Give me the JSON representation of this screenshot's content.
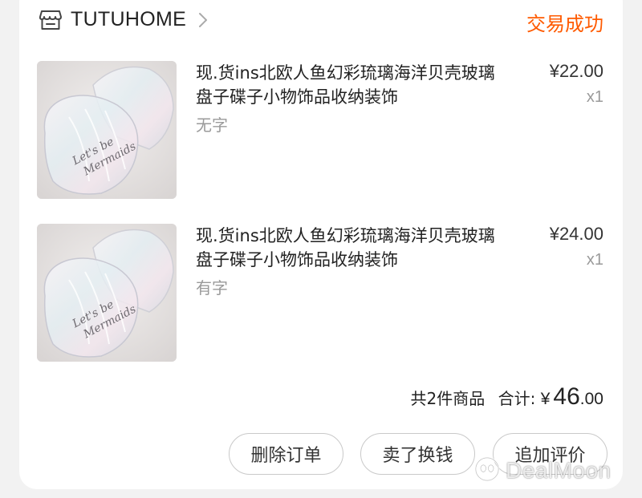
{
  "header": {
    "shop_name": "TUTUHOME",
    "status": "交易成功"
  },
  "items": [
    {
      "title": "现.货ins北欧人鱼幻彩琉璃海洋贝壳玻璃盘子碟子小物饰品收纳装饰",
      "variant": "无字",
      "price": "¥22.00",
      "qty": "x1",
      "image_text": "Let's be Mermaids"
    },
    {
      "title": "现.货ins北欧人鱼幻彩琉璃海洋贝壳玻璃盘子碟子小物饰品收纳装饰",
      "variant": "有字",
      "price": "¥24.00",
      "qty": "x1",
      "image_text": "Let's be Mermaids"
    }
  ],
  "summary": {
    "count_text": "共2件商品",
    "total_label": "合计:",
    "currency": "¥",
    "total_int": "46",
    "total_dec": ".00"
  },
  "actions": {
    "delete": "删除订单",
    "resell": "卖了换钱",
    "review": "追加评价"
  },
  "watermark": "DealMoon",
  "colors": {
    "accent": "#ff5a00",
    "background": "#f2f2f2"
  }
}
